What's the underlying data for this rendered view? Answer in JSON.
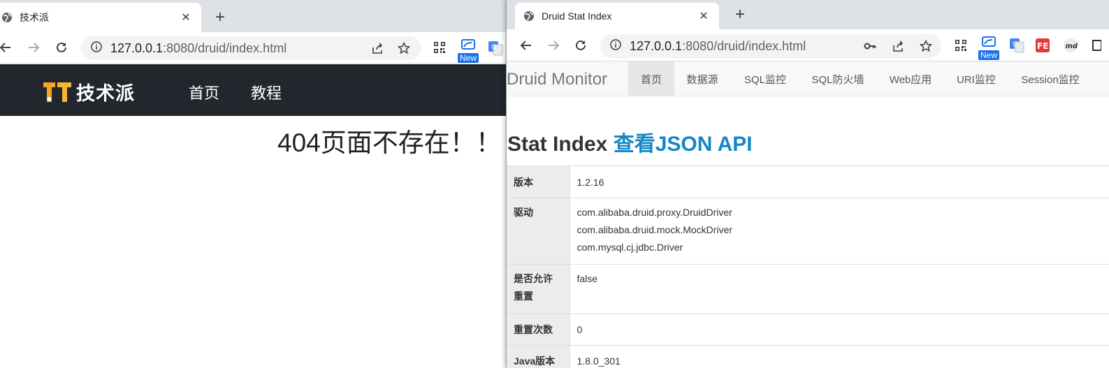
{
  "left_window": {
    "tab": {
      "title": "技术派"
    },
    "address": {
      "host": "127.0.0.1",
      "rest": ":8080/druid/index.html"
    },
    "site": {
      "logo_text": "技术派",
      "nav": [
        "首页",
        "教程"
      ],
      "not_found": "404页面不存在！！"
    }
  },
  "right_window": {
    "tab": {
      "title": "Druid Stat Index"
    },
    "address": {
      "host": "127.0.0.1",
      "rest": ":8080/druid/index.html"
    },
    "extension_badge": "New",
    "druid": {
      "brand": "Druid Monitor",
      "nav": [
        "首页",
        "数据源",
        "SQL监控",
        "SQL防火墙",
        "Web应用",
        "URI监控",
        "Session监控"
      ],
      "active_nav": "首页",
      "heading": "Stat Index",
      "heading_link": "查看JSON API",
      "rows": [
        {
          "key": "版本",
          "value": [
            "1.2.16"
          ]
        },
        {
          "key": "驱动",
          "value": [
            "com.alibaba.druid.proxy.DruidDriver",
            "com.alibaba.druid.mock.MockDriver",
            "com.mysql.cj.jdbc.Driver"
          ]
        },
        {
          "key": "是否允许重置",
          "value": [
            "false"
          ]
        },
        {
          "key": "重置次数",
          "value": [
            "0"
          ]
        },
        {
          "key": "Java版本",
          "value": [
            "1.8.0_301"
          ]
        }
      ]
    }
  },
  "left_extension_badge": "New",
  "colors": {
    "header_bg": "#22262d",
    "link": "#1487c8",
    "logo_orange": "#f5a623"
  }
}
